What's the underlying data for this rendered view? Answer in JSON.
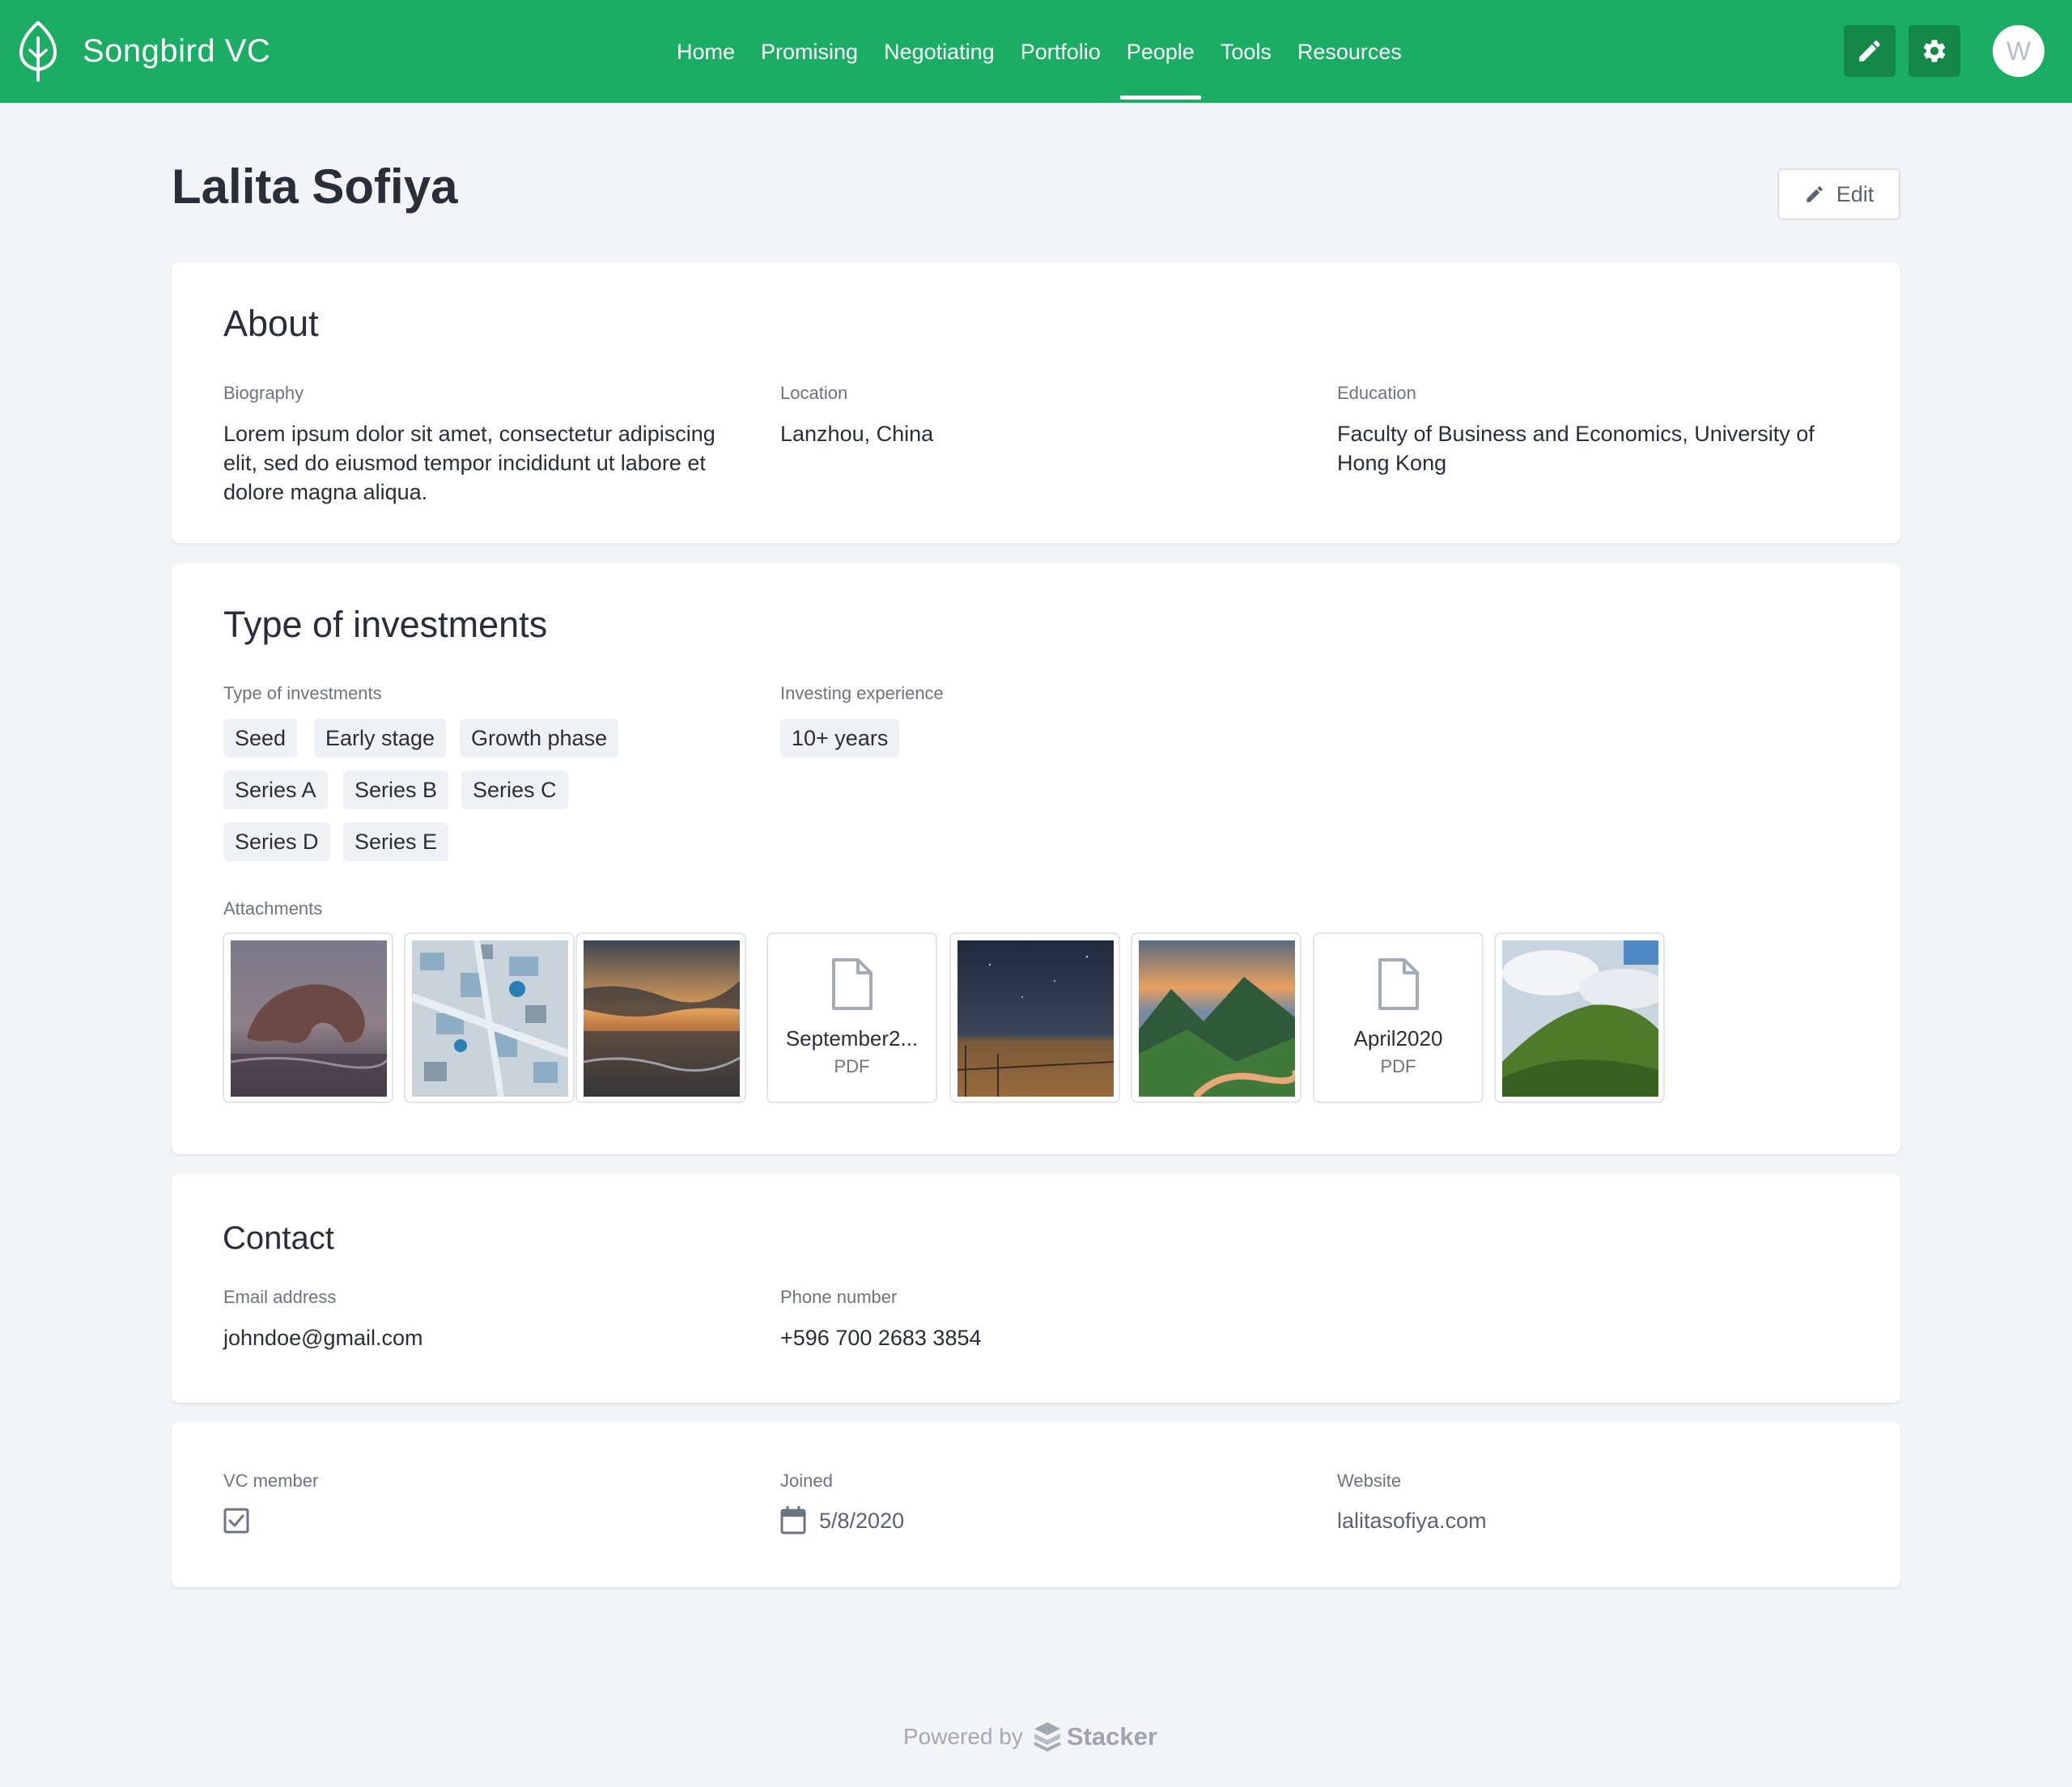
{
  "app": {
    "brand": "Songbird VC",
    "accent_color": "#1bad63",
    "nav": [
      {
        "label": "Home"
      },
      {
        "label": "Promising"
      },
      {
        "label": "Negotiating"
      },
      {
        "label": "Portfolio"
      },
      {
        "label": "People",
        "active": true
      },
      {
        "label": "Tools"
      },
      {
        "label": "Resources"
      }
    ],
    "avatar_letter": "W",
    "icons": {
      "edit": "pencil-icon",
      "settings": "gear-icon",
      "logo": "leaf-logo-icon"
    }
  },
  "page": {
    "title": "Lalita Sofiya",
    "edit_label": "Edit"
  },
  "about": {
    "title": "About",
    "biography_label": "Biography",
    "biography": "Lorem ipsum dolor sit amet, consectetur adipiscing elit, sed do eiusmod tempor incididunt ut labore et dolore magna aliqua.",
    "location_label": "Location",
    "location": "Lanzhou, China",
    "education_label": "Education",
    "education": "Faculty of Business and Economics, University of Hong Kong"
  },
  "investments": {
    "title": "Type of investments",
    "types_label": "Type of investments",
    "types": [
      "Seed",
      "Early stage",
      "Growth phase",
      "Series A",
      "Series B",
      "Series C",
      "Series D",
      "Series E"
    ],
    "experience_label": "Investing experience",
    "experience": "10+ years",
    "attachments_label": "Attachments",
    "attachments": [
      {
        "kind": "image",
        "subject": "coastal rock arch at dusk"
      },
      {
        "kind": "image",
        "subject": "aerial view of white town"
      },
      {
        "kind": "image",
        "subject": "ocean sunset"
      },
      {
        "kind": "file",
        "name": "September2...",
        "type": "PDF"
      },
      {
        "kind": "image",
        "subject": "night sky over field with fence"
      },
      {
        "kind": "image",
        "subject": "mountain valley with river"
      },
      {
        "kind": "file",
        "name": "April2020",
        "type": "PDF"
      },
      {
        "kind": "image",
        "subject": "green hills under cloudy sky"
      }
    ]
  },
  "contact": {
    "title": "Contact",
    "email_label": "Email address",
    "email": "johndoe@gmail.com",
    "phone_label": "Phone number",
    "phone": "+596 700 2683 3854"
  },
  "meta": {
    "vc_member_label": "VC member",
    "vc_member": true,
    "joined_label": "Joined",
    "joined": "5/8/2020",
    "website_label": "Website",
    "website": "lalitasofiya.com"
  },
  "footer": {
    "powered_by": "Powered by",
    "product": "Stacker"
  }
}
